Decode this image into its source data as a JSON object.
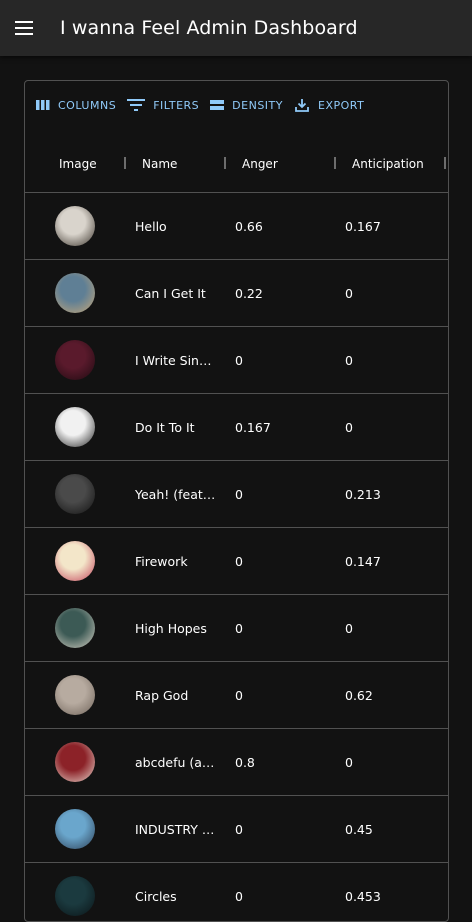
{
  "app": {
    "title": "I wanna Feel Admin Dashboard"
  },
  "toolbar": {
    "columns_label": "COLUMNS",
    "filters_label": "FILTERS",
    "density_label": "DENSITY",
    "export_label": "EXPORT"
  },
  "grid": {
    "columns": [
      "Image",
      "Name",
      "Anger",
      "Anticipation"
    ],
    "rows": [
      {
        "name": "Hello",
        "anger": "0.66",
        "anticipation": "0.167",
        "art_colors": [
          "#d9d4cc",
          "#3a332b"
        ]
      },
      {
        "name": "Can I Get It",
        "anger": "0.22",
        "anticipation": "0",
        "art_colors": [
          "#5f7f95",
          "#c9a878"
        ]
      },
      {
        "name": "I Write Sin…",
        "anger": "0",
        "anticipation": "0",
        "art_colors": [
          "#5a1a2c",
          "#1d0a10"
        ]
      },
      {
        "name": "Do It To It",
        "anger": "0.167",
        "anticipation": "0",
        "art_colors": [
          "#f1f1f1",
          "#222222"
        ]
      },
      {
        "name": "Yeah! (feat…",
        "anger": "0",
        "anticipation": "0.213",
        "art_colors": [
          "#4a4a4a",
          "#111111"
        ]
      },
      {
        "name": "Firework",
        "anger": "0",
        "anticipation": "0.147",
        "art_colors": [
          "#f3e6c9",
          "#c3415a"
        ]
      },
      {
        "name": "High Hopes",
        "anger": "0",
        "anticipation": "0",
        "art_colors": [
          "#3c5a55",
          "#d6d0c4"
        ]
      },
      {
        "name": "Rap God",
        "anger": "0",
        "anticipation": "0.62",
        "art_colors": [
          "#b7aba0",
          "#6f6359"
        ]
      },
      {
        "name": "abcdefu (a…",
        "anger": "0.8",
        "anticipation": "0",
        "art_colors": [
          "#8c2228",
          "#e9dad0"
        ]
      },
      {
        "name": "INDUSTRY …",
        "anger": "0",
        "anticipation": "0.45",
        "art_colors": [
          "#6aa6cc",
          "#2d3f55"
        ]
      },
      {
        "name": "Circles",
        "anger": "0",
        "anticipation": "0.453",
        "art_colors": [
          "#1b3a3f",
          "#0a1316"
        ]
      }
    ]
  },
  "theme": {
    "accent": "#90caf9",
    "appbar_bg": "#272727",
    "page_bg": "#121212",
    "divider": "#515151"
  },
  "icons": [
    "menu-icon",
    "view-column-icon",
    "filter-list-icon",
    "density-icon",
    "download-icon"
  ]
}
